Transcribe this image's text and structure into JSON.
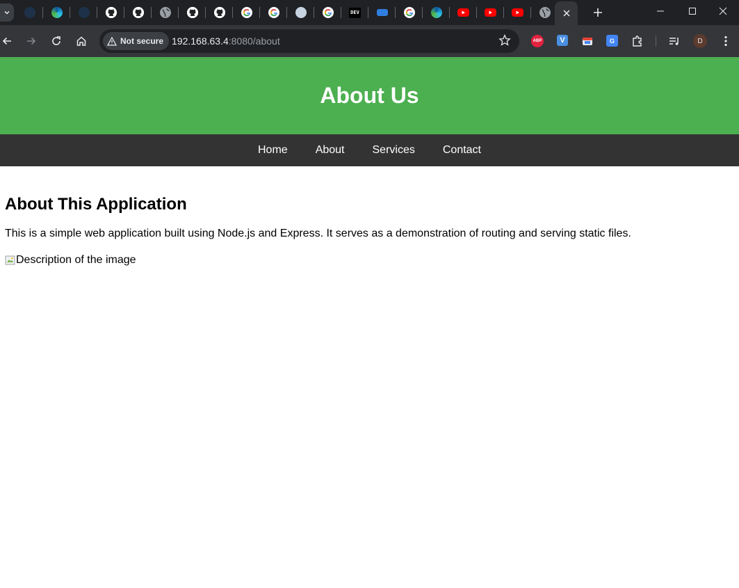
{
  "browser": {
    "tabs": [
      {
        "icon": "edge-icon-faded"
      },
      {
        "icon": "edge-icon"
      },
      {
        "icon": "edge-icon-faded"
      },
      {
        "icon": "github-icon"
      },
      {
        "icon": "github-icon"
      },
      {
        "icon": "globe-icon"
      },
      {
        "icon": "github-icon"
      },
      {
        "icon": "github-icon"
      },
      {
        "icon": "google-icon"
      },
      {
        "icon": "google-icon"
      },
      {
        "icon": "mascot-icon"
      },
      {
        "icon": "google-icon"
      },
      {
        "icon": "dev-icon",
        "label": "DEV"
      },
      {
        "icon": "docker-icon"
      },
      {
        "icon": "google-icon"
      },
      {
        "icon": "edge-icon"
      },
      {
        "icon": "youtube-icon"
      },
      {
        "icon": "youtube-icon"
      },
      {
        "icon": "youtube-icon"
      },
      {
        "icon": "globe-icon"
      },
      {
        "icon": "close-icon",
        "active": true
      }
    ],
    "security_label": "Not secure",
    "url_host": "192.168.63.4",
    "url_rest": ":8080/about",
    "extensions": {
      "abp_label": "ABP",
      "v_label": "V",
      "translate_label": "G",
      "profile_initial": "D"
    },
    "colors": {
      "tabstrip": "#202124",
      "toolbar": "#35363a",
      "omnibox": "#202124"
    }
  },
  "site": {
    "header_title": "About Us",
    "nav": [
      "Home",
      "About",
      "Services",
      "Contact"
    ],
    "content_title": "About This Application",
    "content_text": "This is a simple web application built using Node.js and Express. It serves as a demonstration of routing and serving static files.",
    "image_alt": "Description of the image",
    "colors": {
      "header_bg": "#4caf50",
      "nav_bg": "#333333",
      "text": "#000000"
    }
  }
}
